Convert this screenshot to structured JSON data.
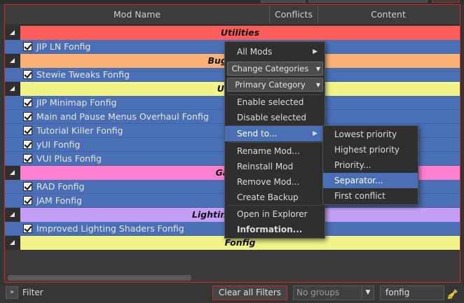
{
  "columns": {
    "mod_name": "Mod Name",
    "conflicts": "Conflicts",
    "content": "Content"
  },
  "separators": [
    {
      "label": "Utilities",
      "color": "#ff5c5c"
    },
    {
      "label": "Bugfix & QoL",
      "color": "#fbb074"
    },
    {
      "label": "UI & HUD",
      "color": "#f2f388"
    },
    {
      "label": "Gameplay",
      "color": "#ff7ecf"
    },
    {
      "label": "Lighting & Weather",
      "color": "#c49ff5"
    },
    {
      "label": "Fonfig",
      "color": "#f2f388"
    }
  ],
  "mods": [
    {
      "name": "JIP LN Fonfig",
      "checked": true
    },
    {
      "name": "Stewie Tweaks Fonfig",
      "checked": true
    },
    {
      "name": "JIP Minimap Fonfig",
      "checked": true
    },
    {
      "name": "Main and Pause Menus Overhaul Fonfig",
      "checked": true
    },
    {
      "name": "Tutorial Killer Fonfig",
      "checked": true
    },
    {
      "name": "yUI Fonfig",
      "checked": true
    },
    {
      "name": "VUI Plus Fonfig",
      "checked": true
    },
    {
      "name": "RAD Fonfig",
      "checked": true
    },
    {
      "name": "JAM Fonfig",
      "checked": true
    },
    {
      "name": "Improved Lighting Shaders Fonfig",
      "checked": true
    }
  ],
  "context_menu": {
    "all_mods": "All Mods",
    "change_categories": "Change Categories",
    "primary_category": "Primary Category",
    "enable_selected": "Enable selected",
    "disable_selected": "Disable selected",
    "send_to": "Send to...",
    "rename_mod": "Rename Mod...",
    "reinstall_mod": "Reinstall Mod",
    "remove_mod": "Remove Mod...",
    "create_backup": "Create Backup",
    "open_in_explorer": "Open in Explorer",
    "information": "Information..."
  },
  "send_to_submenu": {
    "lowest_priority": "Lowest priority",
    "highest_priority": "Highest priority",
    "priority": "Priority...",
    "separator": "Separator...",
    "first_conflict": "First conflict"
  },
  "bottom_bar": {
    "expand_glyph": "»",
    "filter_label": "Filter",
    "clear_filters": "Clear all Filters",
    "groups_value": "No groups",
    "filter_text": "fonfig"
  },
  "colors": {
    "accent": "#4a6fb5",
    "mod_row": "#4a6fb5",
    "frame_border": "#d02a2a"
  },
  "icons": {
    "separator_toggle": "collapse-triangle-icon",
    "clear_filter": "broom-icon",
    "submenu": "chevron-right-icon"
  }
}
